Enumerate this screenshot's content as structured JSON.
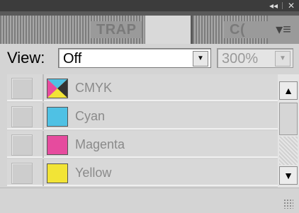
{
  "titlebar": {
    "collapse_glyph": "◂◂",
    "close_glyph": "✕"
  },
  "tabs": [
    {
      "label": "TRAP",
      "active": false
    },
    {
      "label": "",
      "active": true
    },
    {
      "label": "C(",
      "active": false
    }
  ],
  "panel_menu_glyph": "▾≡",
  "view": {
    "label": "View:",
    "value": "Off",
    "zoom": "300%"
  },
  "channels": [
    {
      "name": "CMYK",
      "swatch": "cmyk"
    },
    {
      "name": "Cyan",
      "swatch": "#4fc1e4"
    },
    {
      "name": "Magenta",
      "swatch": "#e64b9e"
    },
    {
      "name": "Yellow",
      "swatch": "#f2e436"
    }
  ],
  "scrollbar": {
    "up_glyph": "▲",
    "down_glyph": "▼"
  },
  "icons": {
    "collapse": "double-left-arrow-icon",
    "close": "close-icon",
    "menu": "panel-menu-icon",
    "dropdown": "chevron-down-icon",
    "resize": "resize-grip-icon"
  }
}
